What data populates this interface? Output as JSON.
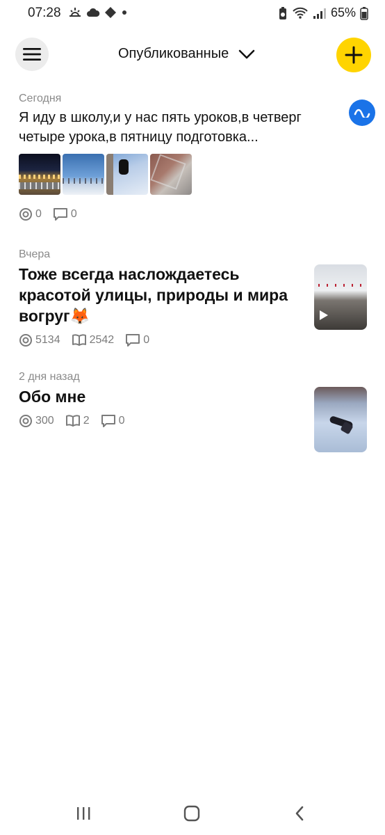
{
  "status_bar": {
    "time": "07:28",
    "battery": "65%",
    "left_icons": [
      "sunrise-icon",
      "cloud-icon",
      "diamond-icon",
      "dot-icon"
    ],
    "right_icons": [
      "recycle-battery-icon",
      "wifi-icon",
      "signal-icon",
      "battery-icon"
    ]
  },
  "header": {
    "title": "Опубликованные",
    "menu_icon": "hamburger-icon",
    "dropdown_icon": "chevron-down-icon",
    "add_icon": "plus-icon"
  },
  "feed": [
    {
      "date": "Сегодня",
      "text_line1": "Я иду в школу,и у нас пять уроков,в четверг",
      "text_line2": "четыре урока,в пятницу подготовка...",
      "views": "0",
      "comments": "0"
    },
    {
      "date": "Вчера",
      "title_line1": "Тоже всегда наслождаетесь",
      "title_line2": "красотой улицы, природы и мира",
      "title_line3": "вогруг🦊",
      "views": "5134",
      "reads": "2542",
      "comments": "0"
    },
    {
      "date": "2 дня назад",
      "title": "Обо мне",
      "views": "300",
      "reads": "2",
      "comments": "0"
    }
  ],
  "colors": {
    "accent_yellow": "#ffd400",
    "accent_blue": "#1a73e8",
    "muted_text": "#8a8a8a"
  },
  "nav": [
    "recent-apps-icon",
    "home-icon",
    "back-icon"
  ]
}
